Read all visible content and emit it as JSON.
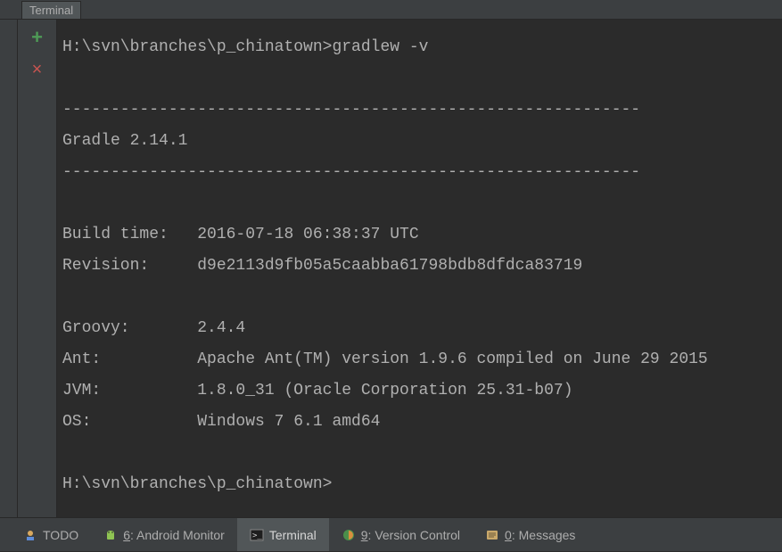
{
  "title_bar": {
    "label": "Terminal"
  },
  "gutter": {
    "add_tab": "+",
    "close_tab": "×"
  },
  "terminal": {
    "lines": [
      "H:\\svn\\branches\\p_chinatown>gradlew -v",
      "",
      "------------------------------------------------------------",
      "Gradle 2.14.1",
      "------------------------------------------------------------",
      "",
      "Build time:   2016-07-18 06:38:37 UTC",
      "Revision:     d9e2113d9fb05a5caabba61798bdb8dfdca83719",
      "",
      "Groovy:       2.4.4",
      "Ant:          Apache Ant(TM) version 1.9.6 compiled on June 29 2015",
      "JVM:          1.8.0_31 (Oracle Corporation 25.31-b07)",
      "OS:           Windows 7 6.1 amd64",
      "",
      "H:\\svn\\branches\\p_chinatown>"
    ]
  },
  "bottom_tabs": {
    "todo": {
      "label": "TODO"
    },
    "android_monitor": {
      "num": "6",
      "label": ": Android Monitor"
    },
    "terminal": {
      "label": "Terminal"
    },
    "version_control": {
      "num": "9",
      "label": ": Version Control"
    },
    "messages": {
      "num": "0",
      "label": ": Messages"
    }
  }
}
